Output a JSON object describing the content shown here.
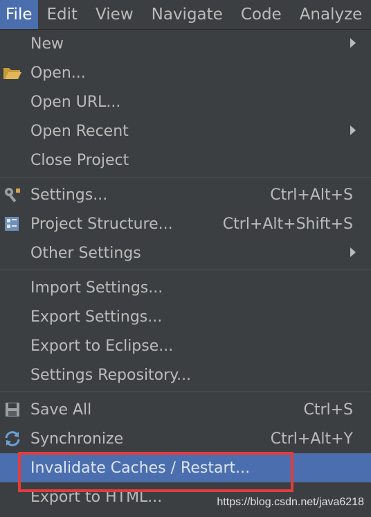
{
  "menubar": {
    "items": [
      "File",
      "Edit",
      "View",
      "Navigate",
      "Code",
      "Analyze"
    ]
  },
  "file_menu": {
    "new": {
      "label": "New"
    },
    "open": {
      "label": "Open...",
      "icon": "folder-icon"
    },
    "open_url": {
      "label": "Open URL..."
    },
    "open_recent": {
      "label": "Open Recent"
    },
    "close_project": {
      "label": "Close Project"
    },
    "settings": {
      "label": "Settings...",
      "shortcut": "Ctrl+Alt+S",
      "icon": "wrench-icon"
    },
    "project_structure": {
      "label": "Project Structure...",
      "shortcut": "Ctrl+Alt+Shift+S",
      "icon": "project-structure-icon"
    },
    "other_settings": {
      "label": "Other Settings"
    },
    "import_settings": {
      "label": "Import Settings..."
    },
    "export_settings": {
      "label": "Export Settings..."
    },
    "export_eclipse": {
      "label": "Export to Eclipse..."
    },
    "settings_repo": {
      "label": "Settings Repository..."
    },
    "save_all": {
      "label": "Save All",
      "shortcut": "Ctrl+S",
      "icon": "save-icon"
    },
    "synchronize": {
      "label": "Synchronize",
      "shortcut": "Ctrl+Alt+Y",
      "icon": "sync-icon"
    },
    "invalidate": {
      "label": "Invalidate Caches / Restart..."
    },
    "export_html": {
      "label": "Export to HTML..."
    }
  },
  "colors": {
    "background": "#3c3f41",
    "highlight": "#4b6eaf",
    "annotation": "#e33b3b"
  },
  "watermark": "https://blog.csdn.net/java6218"
}
